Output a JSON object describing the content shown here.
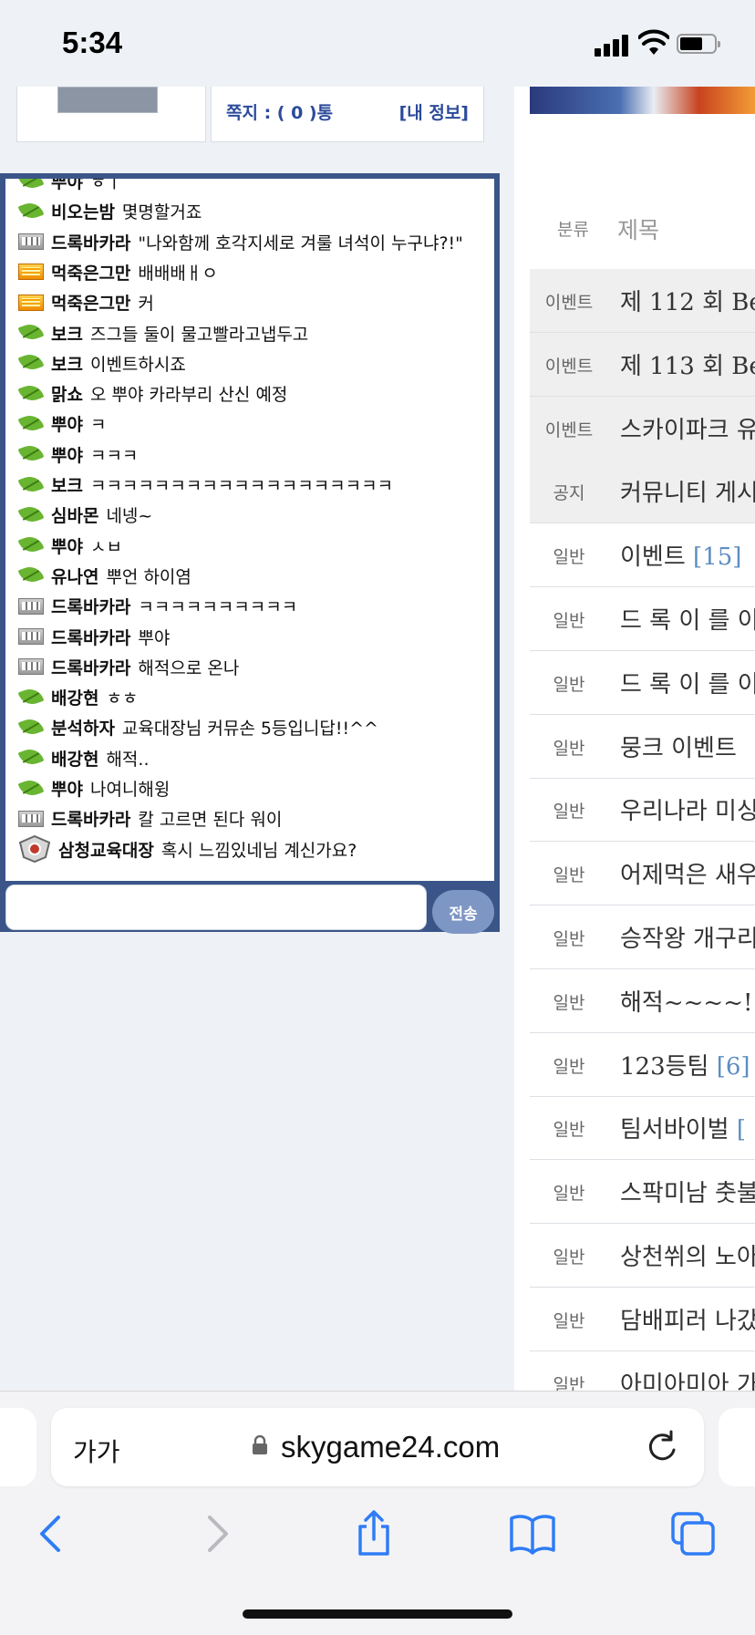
{
  "status": {
    "time": "5:34"
  },
  "top": {
    "messages_label": "쪽지 : ( 0 )통",
    "my_info_label": "[내 정보]"
  },
  "chat": {
    "messages": [
      {
        "nick": "뿌야",
        "text": "ㅎㅣ",
        "badge": "leaf"
      },
      {
        "nick": "비오는밤",
        "text": "몇명할거죠",
        "badge": "leaf"
      },
      {
        "nick": "드록바카라",
        "text": "\"나와함께 호각지세로 겨룰 녀석이 누구냐?!\"",
        "badge": "silver"
      },
      {
        "nick": "먹죽은그만",
        "text": "배배배ㅐㅇ",
        "badge": "gold"
      },
      {
        "nick": "먹죽은그만",
        "text": "커",
        "badge": "gold"
      },
      {
        "nick": "보크",
        "text": "즈그들 둘이 물고빨라고냅두고",
        "badge": "leaf"
      },
      {
        "nick": "보크",
        "text": "이벤트하시죠",
        "badge": "leaf"
      },
      {
        "nick": "맑쇼",
        "text": "오 뿌야 카라부리 산신 예정",
        "badge": "leaf"
      },
      {
        "nick": "뿌야",
        "text": "ㅋ",
        "badge": "leaf"
      },
      {
        "nick": "뿌야",
        "text": "ㅋㅋㅋ",
        "badge": "leaf"
      },
      {
        "nick": "보크",
        "text": "ㅋㅋㅋㅋㅋㅋㅋㅋㅋㅋㅋㅋㅋㅋㅋㅋㅋㅋㅋ",
        "badge": "leaf"
      },
      {
        "nick": "심바몬",
        "text": "네넹~",
        "badge": "leaf"
      },
      {
        "nick": "뿌야",
        "text": "ㅅㅂ",
        "badge": "leaf"
      },
      {
        "nick": "유나연",
        "text": "뿌언 하이염",
        "badge": "leaf"
      },
      {
        "nick": "드록바카라",
        "text": "ㅋㅋㅋㅋㅋㅋㅋㅋㅋㅋ",
        "badge": "silver"
      },
      {
        "nick": "드록바카라",
        "text": "뿌야",
        "badge": "silver"
      },
      {
        "nick": "드록바카라",
        "text": "해적으로 온나",
        "badge": "silver"
      },
      {
        "nick": "배강현",
        "text": "ㅎㅎ",
        "badge": "leaf"
      },
      {
        "nick": "분석하자",
        "text": "교육대장님 커뮤손 5등입니답!!^^",
        "badge": "leaf"
      },
      {
        "nick": "배강현",
        "text": "해적..",
        "badge": "leaf"
      },
      {
        "nick": "뿌야",
        "text": "나여니해윙",
        "badge": "leaf"
      },
      {
        "nick": "드록바카라",
        "text": "칼 고르면 된다 워이",
        "badge": "silver"
      },
      {
        "nick": "삼청교육대장",
        "text": "혹시 느낌있네님 계신가요?",
        "badge": "admin"
      }
    ],
    "send_label": "전송"
  },
  "board": {
    "header": {
      "category": "분류",
      "title": "제목"
    },
    "rows": [
      {
        "cat": "이벤트",
        "title": "제 112 회 Be",
        "count": "",
        "shaded": true
      },
      {
        "cat": "이벤트",
        "title": "제 113 회 Be",
        "count": "",
        "shaded": true
      },
      {
        "cat": "이벤트",
        "title": "스카이파크 유",
        "count": "",
        "shaded": true
      },
      {
        "cat": "공지",
        "title": "커뮤니티 게시",
        "count": "",
        "shaded": true
      },
      {
        "cat": "일반",
        "title": "이벤트 ",
        "count": "[15]",
        "shaded": false
      },
      {
        "cat": "일반",
        "title": "드 록 이 를 이",
        "count": "",
        "shaded": false
      },
      {
        "cat": "일반",
        "title": "드 록 이 를 이",
        "count": "",
        "shaded": false
      },
      {
        "cat": "일반",
        "title": "뭉크 이벤트 ",
        "count": "",
        "shaded": false
      },
      {
        "cat": "일반",
        "title": "우리나라 미싱",
        "count": "",
        "shaded": false
      },
      {
        "cat": "일반",
        "title": "어제먹은 새우",
        "count": "",
        "shaded": false
      },
      {
        "cat": "일반",
        "title": "승작왕 개구리",
        "count": "",
        "shaded": false
      },
      {
        "cat": "일반",
        "title": "해적~~~~!! ",
        "count": "",
        "shaded": false
      },
      {
        "cat": "일반",
        "title": "123등팀 ",
        "count": "[6]",
        "shaded": false
      },
      {
        "cat": "일반",
        "title": "팀서바이벌 ",
        "count": "[",
        "shaded": false
      },
      {
        "cat": "일반",
        "title": "스팍미남 춧불",
        "count": "",
        "shaded": false
      },
      {
        "cat": "일반",
        "title": "상천쒸의 노아",
        "count": "",
        "shaded": false
      },
      {
        "cat": "일반",
        "title": "담배피러 나갔",
        "count": "",
        "shaded": false
      },
      {
        "cat": "일반",
        "title": "아미아미아 가",
        "count": "",
        "shaded": false
      }
    ]
  },
  "browser": {
    "text_size_label": "가가",
    "url": "skygame24.com"
  }
}
